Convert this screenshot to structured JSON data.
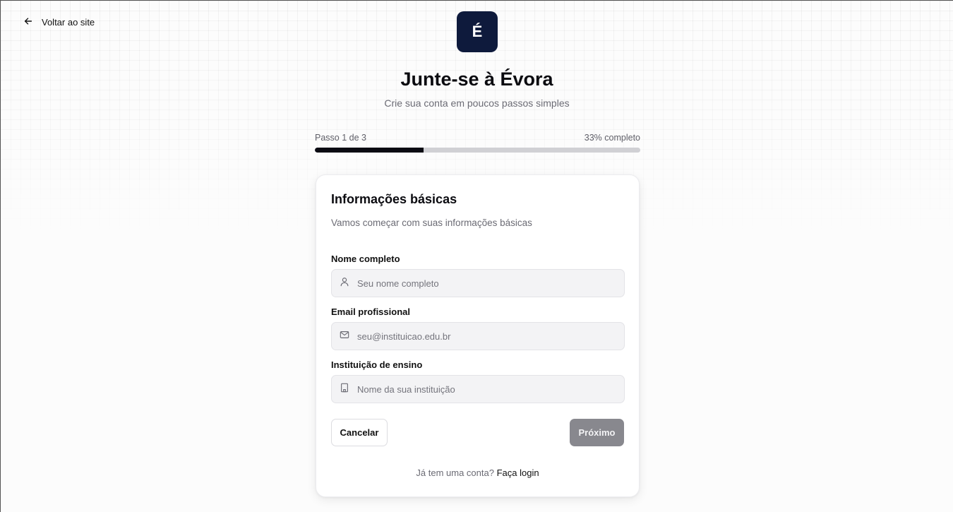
{
  "nav": {
    "back_label": "Voltar ao site"
  },
  "brand": {
    "logo_letter": "É",
    "logo_bg": "#0e1a3c"
  },
  "header": {
    "title": "Junte-se à Évora",
    "subtitle": "Crie sua conta em poucos passos simples"
  },
  "progress": {
    "step_label": "Passo 1 de 3",
    "percent_label": "33% completo",
    "fraction": 0.333
  },
  "form": {
    "title": "Informações básicas",
    "description": "Vamos começar com suas informações básicas",
    "fields": [
      {
        "label": "Nome completo",
        "placeholder": "Seu nome completo",
        "value": "",
        "icon": "user-icon"
      },
      {
        "label": "Email profissional",
        "placeholder": "seu@instituicao.edu.br",
        "value": "",
        "icon": "mail-icon"
      },
      {
        "label": "Instituição de ensino",
        "placeholder": "Nome da sua instituição",
        "value": "",
        "icon": "building-icon"
      }
    ],
    "cancel_label": "Cancelar",
    "next_label": "Próximo",
    "login_prompt": "Já tem uma conta?",
    "login_link": "Faça login"
  },
  "colors": {
    "accent": "#0a0a12",
    "progress_track": "#d0d0d4",
    "next_button_disabled": "#88888e"
  }
}
